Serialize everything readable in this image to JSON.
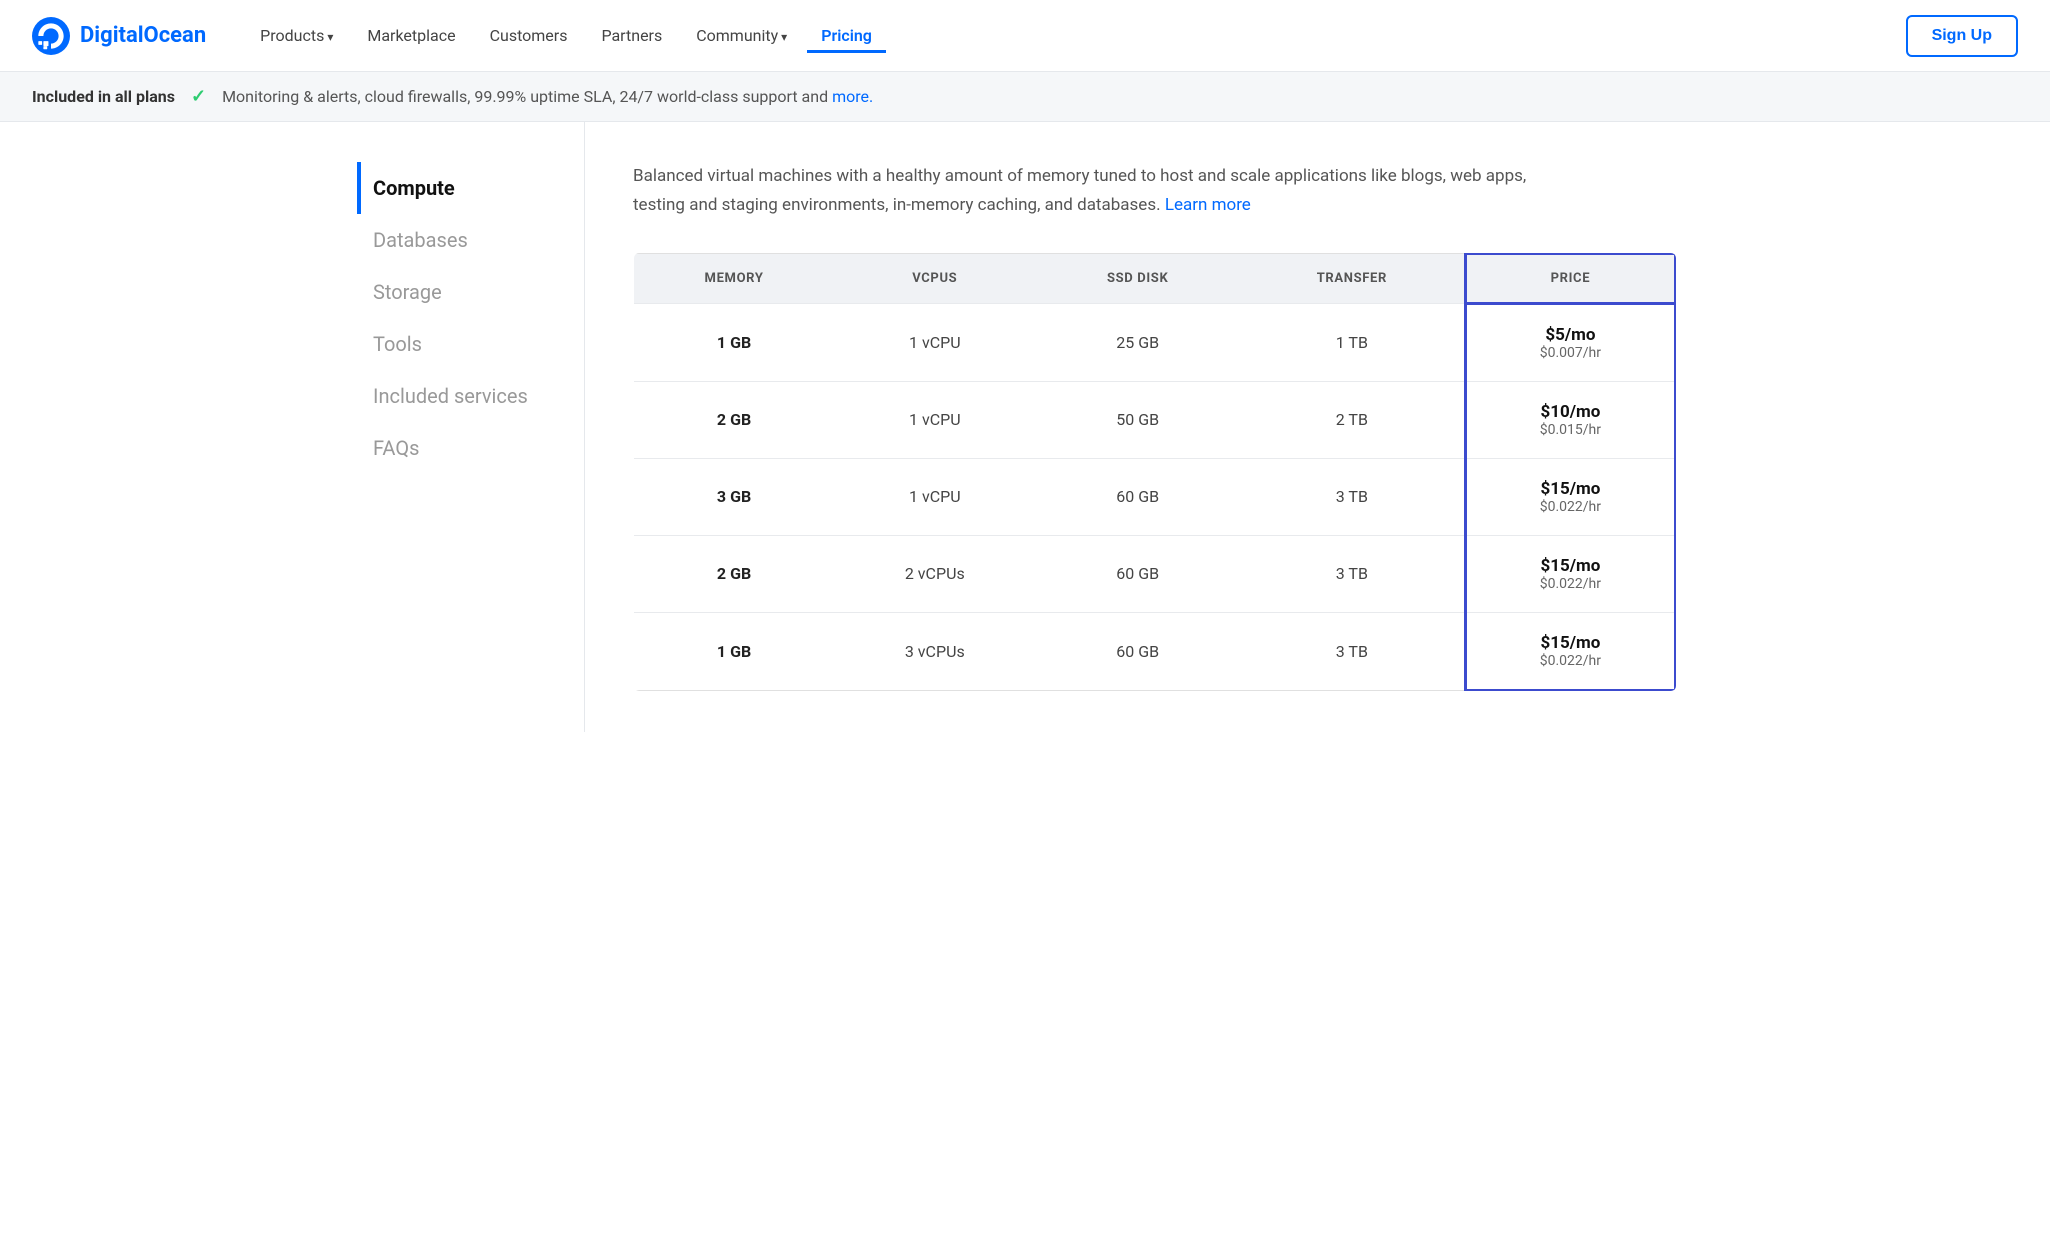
{
  "nav": {
    "logo_text": "DigitalOcean",
    "links": [
      {
        "label": "Products",
        "has_arrow": true,
        "active": false
      },
      {
        "label": "Marketplace",
        "has_arrow": false,
        "active": false
      },
      {
        "label": "Customers",
        "has_arrow": false,
        "active": false
      },
      {
        "label": "Partners",
        "has_arrow": false,
        "active": false
      },
      {
        "label": "Community",
        "has_arrow": true,
        "active": false
      },
      {
        "label": "Pricing",
        "has_arrow": false,
        "active": true
      }
    ],
    "signup_label": "Sign Up"
  },
  "banner": {
    "label": "Included in all plans",
    "text": "Monitoring & alerts, cloud firewalls, 99.99% uptime SLA, 24/7 world-class support and ",
    "link_text": "more."
  },
  "sidebar": {
    "items": [
      {
        "label": "Compute",
        "active": true
      },
      {
        "label": "Databases",
        "active": false
      },
      {
        "label": "Storage",
        "active": false
      },
      {
        "label": "Tools",
        "active": false
      },
      {
        "label": "Included services",
        "active": false
      },
      {
        "label": "FAQs",
        "active": false
      }
    ]
  },
  "content": {
    "description": "Balanced virtual machines with a healthy amount of memory tuned to host and scale applications like blogs, web apps, testing and staging environments, in-memory caching, and databases.",
    "learn_more_label": "Learn more",
    "table": {
      "headers": [
        "MEMORY",
        "VCPUS",
        "SSD DISK",
        "TRANSFER",
        "PRICE"
      ],
      "rows": [
        {
          "memory": "1 GB",
          "vcpus": "1 vCPU",
          "ssd": "25 GB",
          "transfer": "1 TB",
          "price_mo": "$5/mo",
          "price_hr": "$0.007/hr"
        },
        {
          "memory": "2 GB",
          "vcpus": "1 vCPU",
          "ssd": "50 GB",
          "transfer": "2 TB",
          "price_mo": "$10/mo",
          "price_hr": "$0.015/hr"
        },
        {
          "memory": "3 GB",
          "vcpus": "1 vCPU",
          "ssd": "60 GB",
          "transfer": "3 TB",
          "price_mo": "$15/mo",
          "price_hr": "$0.022/hr"
        },
        {
          "memory": "2 GB",
          "vcpus": "2 vCPUs",
          "ssd": "60 GB",
          "transfer": "3 TB",
          "price_mo": "$15/mo",
          "price_hr": "$0.022/hr"
        },
        {
          "memory": "1 GB",
          "vcpus": "3 vCPUs",
          "ssd": "60 GB",
          "transfer": "3 TB",
          "price_mo": "$15/mo",
          "price_hr": "$0.022/hr"
        }
      ]
    }
  },
  "colors": {
    "accent": "#0069ff",
    "price_border": "#3c4bce",
    "check_green": "#2ecc71"
  }
}
